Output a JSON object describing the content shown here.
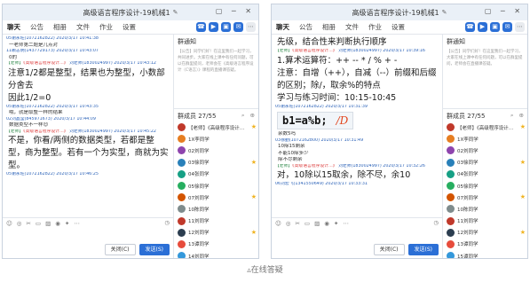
{
  "caption": "▵在线答疑",
  "win_title": "高级语言程序设计-19机械1",
  "tabs": [
    "聊天",
    "公告",
    "相册",
    "文件",
    "作业",
    "设置"
  ],
  "panel": {
    "notice_title": "群通知",
    "notice_left": "【公告】同学们好！在这里我们一起学习，共同进步。大家在线上课中有任何问题，可以在群里提问，老师会在《高级语言程序设计（C语言）》课程的直播课答疑。",
    "notice_right": "【公告】同学们好！在这里我们一起学习，大家在线上课中有任何问题，可以在群里提问，老师会在直播课答疑。",
    "members_left": "群成员 27/55",
    "members_right": "群成员 27/55"
  },
  "members_left": [
    {
      "name": "【老师】《高级程序设计…",
      "color": "#c0392b"
    },
    {
      "name": "1X李同学",
      "color": "#e67e22"
    },
    {
      "name": "02刘同学",
      "color": "#8e44ad"
    },
    {
      "name": "03徐同学",
      "color": "#2980b9"
    },
    {
      "name": "04张同学",
      "color": "#16a085"
    },
    {
      "name": "05徐同学",
      "color": "#27ae60"
    },
    {
      "name": "07刘同学",
      "color": "#d35400"
    },
    {
      "name": "10陈同学",
      "color": "#7f8c8d"
    },
    {
      "name": "11刘同学",
      "color": "#c0392b"
    },
    {
      "name": "12刘同学",
      "color": "#2c3e50"
    },
    {
      "name": "13谭同学",
      "color": "#e74c3c"
    },
    {
      "name": "14刘同学",
      "color": "#3498db"
    }
  ],
  "members_right": [
    {
      "name": "【老师】《高级程序设计…",
      "color": "#c0392b"
    },
    {
      "name": "1X李同学",
      "color": "#e67e22"
    },
    {
      "name": "02刘同学",
      "color": "#8e44ad"
    },
    {
      "name": "03徐同学",
      "color": "#2980b9"
    },
    {
      "name": "04张同学",
      "color": "#16a085"
    },
    {
      "name": "05徐同学",
      "color": "#27ae60"
    },
    {
      "name": "07刘同学",
      "color": "#d35400"
    },
    {
      "name": "10陈同学",
      "color": "#7f8c8d"
    },
    {
      "name": "11刘同学",
      "color": "#c0392b"
    },
    {
      "name": "12刘同学",
      "color": "#2c3e50"
    },
    {
      "name": "13谭同学",
      "color": "#e74c3c"
    },
    {
      "name": "15谭同学",
      "color": "#3498db"
    }
  ],
  "chat_left": {
    "m1_meta": "05谢永旺(1072162822) 2020/3/17 10:41:38",
    "m1_text": "一老师第二题是几点对",
    "m2_meta": "11赖志明(1437729173) 2020/3/17 10:43:07",
    "m2_text": "0的",
    "m3_role": "【老师】",
    "m3_name": "《高级语言程序设计…》",
    "m3_meta": "刘老师(1830024997) 2020/3/17 10:43:12",
    "m3_b1": "注意1/2都是整型，结果也为整型，小数部分舍去",
    "m3_b2": "因此1/2=0",
    "m4_meta": "05谢永旺(1072162822) 2020/3/17 10:43:35",
    "m4_text": "哦，就是取整一样的结果",
    "m5_meta": "02刘晶莹(845971673) 2020/3/17 10:44:09",
    "m5_text": "数据类型不一样😊",
    "m6_role": "【老师】",
    "m6_name": "《高级语言程序设计…》",
    "m6_meta": "刘老师(1830024997) 2020/3/17 10:45:22",
    "m6_b1": "不是，你看/两侧的数据类型，若都是整型，商为整型。若有一个为实型，商就为实型。",
    "m7_meta": "05谢永旺(1072162822) 2020/3/17 10:46:25"
  },
  "chat_right": {
    "r_b0": "先级，结合性来判断执行顺序",
    "r_m1_role": "【老师】",
    "r_m1_name": "《高级语言程序设计…》",
    "r_m1_meta": "刘老师(1830024997) 2020/3/17 10:39:16",
    "r_b1": "1.算术运算符：++ -- * / % + -",
    "r_b2": "注意：自增（++），自减（--）前缀和后缀的区别；除/，取余%的特点",
    "r_b3": "学习与练习时间：10:15-10:45",
    "r_m2_meta": "05谢永旺(1072162822) 2020/3/17 10:31:39",
    "r_code": "b1=a%b;",
    "r_hand": "/D",
    "r_m3_text": "余数5吗",
    "r_m4_meta": "03徐勤(1072162800) 2020/3/17 10:31:49",
    "r_m4_text": "10除15剩余",
    "r_m5_text": "不能10除多少",
    "r_m6_text": "除不尽剩余",
    "r_m7_role": "【老师】",
    "r_m7_name": "《高级语言程序设计…》",
    "r_m7_meta": "刘老师(1830024997) 2020/3/17 10:32:26",
    "r_b4": "对，10除以15取余，除不尽，余10",
    "r_m8_meta": "06刘宏飞(1341550649) 2020/3/17 10:33:31"
  },
  "composer": {
    "close_label": "关闭(C)",
    "send_label": "发送(S)"
  }
}
